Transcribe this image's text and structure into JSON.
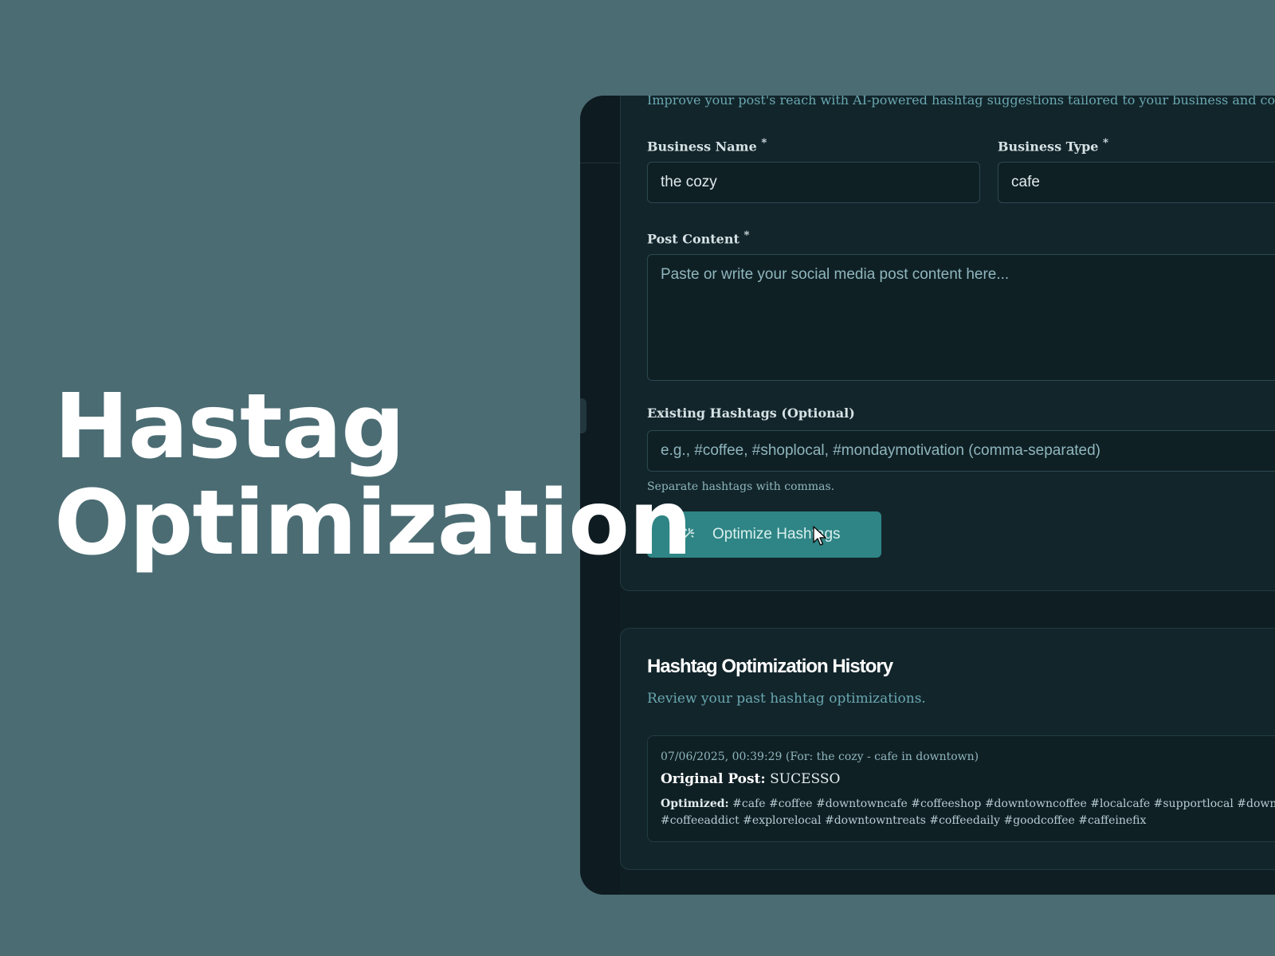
{
  "hero": {
    "line1": "Hastag",
    "line2": "Optimization"
  },
  "form": {
    "intro": "Improve your post's reach with AI-powered hashtag suggestions tailored to your business and content. Yo",
    "business_name": {
      "label": "Business Name",
      "required_mark": "*",
      "value": "the cozy"
    },
    "business_type": {
      "label": "Business Type",
      "required_mark": "*",
      "value": "cafe"
    },
    "post_content": {
      "label": "Post Content",
      "required_mark": "*",
      "placeholder": "Paste or write your social media post content here..."
    },
    "existing_hashtags": {
      "label": "Existing Hashtags (Optional)",
      "placeholder": "e.g., #coffee, #shoplocal, #mondaymotivation (comma-separated)",
      "helper": "Separate hashtags with commas."
    },
    "submit_label": "Optimize Hashtags",
    "submit_icon": "magic-wand-icon"
  },
  "history": {
    "title": "Hashtag Optimization History",
    "subtitle": "Review your past hashtag optimizations.",
    "entries": [
      {
        "meta": "07/06/2025, 00:39:29 (For: the cozy - cafe in downtown)",
        "original_label": "Original Post:",
        "original_value": "SUCESSO",
        "optimized_label": "Optimized:",
        "optimized_line1": "#cafe #coffee #downtowncafe #coffeeshop #downtowncoffee #localcafe #supportlocal #downtown #coffeesho",
        "optimized_line2": "#coffeeaddict #explorelocal #downtowntreats #coffeedaily #goodcoffee #caffeinefix"
      }
    ]
  },
  "colors": {
    "background": "#4b6c73",
    "panel": "#12252b",
    "accent": "#2f8585",
    "muted_text": "#6aa7b0"
  }
}
